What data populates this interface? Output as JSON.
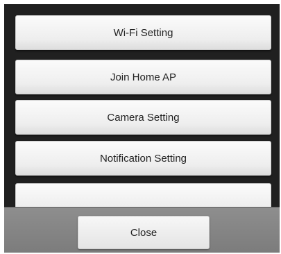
{
  "settings_menu": {
    "items": [
      {
        "label": "Wi-Fi Setting"
      },
      {
        "label": "Join Home AP"
      },
      {
        "label": "Camera Setting"
      },
      {
        "label": "Notification Setting"
      },
      {
        "label": ""
      }
    ]
  },
  "footer": {
    "close_label": "Close"
  },
  "colors": {
    "panel_background": "#202020",
    "button_face": "#eeeeee",
    "footer_background": "#858585"
  }
}
